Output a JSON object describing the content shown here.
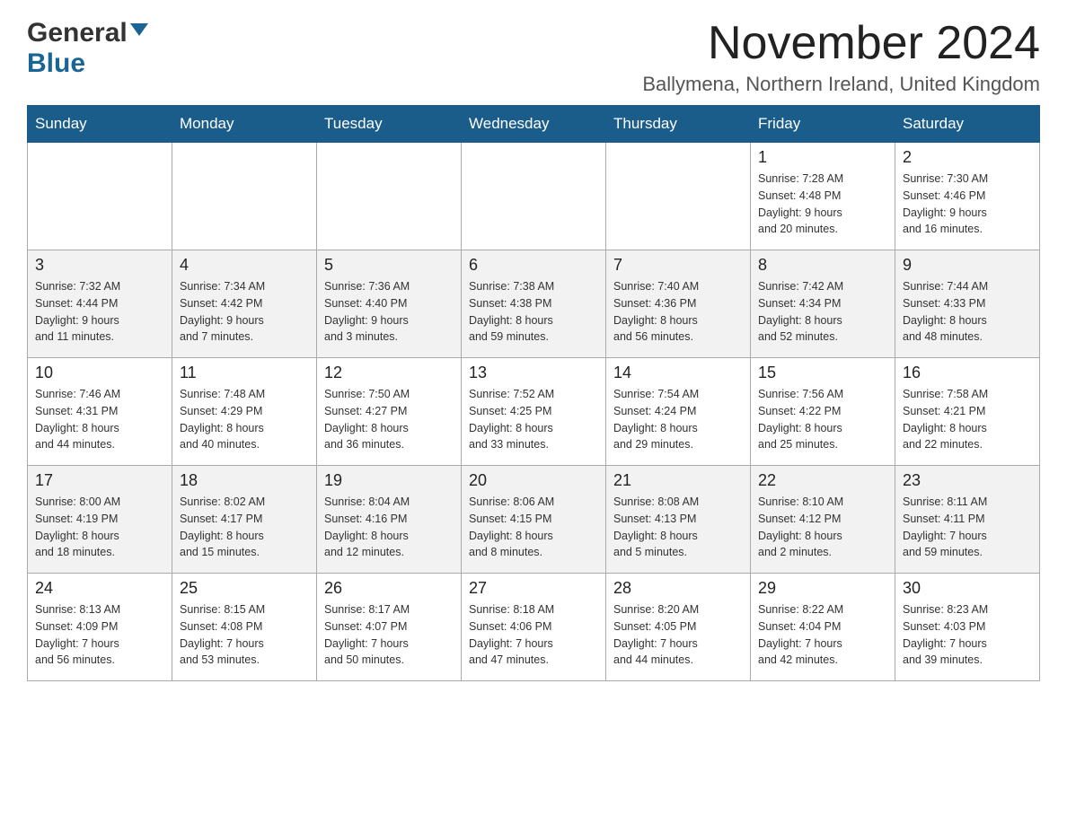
{
  "header": {
    "logo_general": "General",
    "logo_blue": "Blue",
    "title": "November 2024",
    "location": "Ballymena, Northern Ireland, United Kingdom"
  },
  "days_of_week": [
    "Sunday",
    "Monday",
    "Tuesday",
    "Wednesday",
    "Thursday",
    "Friday",
    "Saturday"
  ],
  "weeks": [
    [
      {
        "day": "",
        "info": ""
      },
      {
        "day": "",
        "info": ""
      },
      {
        "day": "",
        "info": ""
      },
      {
        "day": "",
        "info": ""
      },
      {
        "day": "",
        "info": ""
      },
      {
        "day": "1",
        "info": "Sunrise: 7:28 AM\nSunset: 4:48 PM\nDaylight: 9 hours\nand 20 minutes."
      },
      {
        "day": "2",
        "info": "Sunrise: 7:30 AM\nSunset: 4:46 PM\nDaylight: 9 hours\nand 16 minutes."
      }
    ],
    [
      {
        "day": "3",
        "info": "Sunrise: 7:32 AM\nSunset: 4:44 PM\nDaylight: 9 hours\nand 11 minutes."
      },
      {
        "day": "4",
        "info": "Sunrise: 7:34 AM\nSunset: 4:42 PM\nDaylight: 9 hours\nand 7 minutes."
      },
      {
        "day": "5",
        "info": "Sunrise: 7:36 AM\nSunset: 4:40 PM\nDaylight: 9 hours\nand 3 minutes."
      },
      {
        "day": "6",
        "info": "Sunrise: 7:38 AM\nSunset: 4:38 PM\nDaylight: 8 hours\nand 59 minutes."
      },
      {
        "day": "7",
        "info": "Sunrise: 7:40 AM\nSunset: 4:36 PM\nDaylight: 8 hours\nand 56 minutes."
      },
      {
        "day": "8",
        "info": "Sunrise: 7:42 AM\nSunset: 4:34 PM\nDaylight: 8 hours\nand 52 minutes."
      },
      {
        "day": "9",
        "info": "Sunrise: 7:44 AM\nSunset: 4:33 PM\nDaylight: 8 hours\nand 48 minutes."
      }
    ],
    [
      {
        "day": "10",
        "info": "Sunrise: 7:46 AM\nSunset: 4:31 PM\nDaylight: 8 hours\nand 44 minutes."
      },
      {
        "day": "11",
        "info": "Sunrise: 7:48 AM\nSunset: 4:29 PM\nDaylight: 8 hours\nand 40 minutes."
      },
      {
        "day": "12",
        "info": "Sunrise: 7:50 AM\nSunset: 4:27 PM\nDaylight: 8 hours\nand 36 minutes."
      },
      {
        "day": "13",
        "info": "Sunrise: 7:52 AM\nSunset: 4:25 PM\nDaylight: 8 hours\nand 33 minutes."
      },
      {
        "day": "14",
        "info": "Sunrise: 7:54 AM\nSunset: 4:24 PM\nDaylight: 8 hours\nand 29 minutes."
      },
      {
        "day": "15",
        "info": "Sunrise: 7:56 AM\nSunset: 4:22 PM\nDaylight: 8 hours\nand 25 minutes."
      },
      {
        "day": "16",
        "info": "Sunrise: 7:58 AM\nSunset: 4:21 PM\nDaylight: 8 hours\nand 22 minutes."
      }
    ],
    [
      {
        "day": "17",
        "info": "Sunrise: 8:00 AM\nSunset: 4:19 PM\nDaylight: 8 hours\nand 18 minutes."
      },
      {
        "day": "18",
        "info": "Sunrise: 8:02 AM\nSunset: 4:17 PM\nDaylight: 8 hours\nand 15 minutes."
      },
      {
        "day": "19",
        "info": "Sunrise: 8:04 AM\nSunset: 4:16 PM\nDaylight: 8 hours\nand 12 minutes."
      },
      {
        "day": "20",
        "info": "Sunrise: 8:06 AM\nSunset: 4:15 PM\nDaylight: 8 hours\nand 8 minutes."
      },
      {
        "day": "21",
        "info": "Sunrise: 8:08 AM\nSunset: 4:13 PM\nDaylight: 8 hours\nand 5 minutes."
      },
      {
        "day": "22",
        "info": "Sunrise: 8:10 AM\nSunset: 4:12 PM\nDaylight: 8 hours\nand 2 minutes."
      },
      {
        "day": "23",
        "info": "Sunrise: 8:11 AM\nSunset: 4:11 PM\nDaylight: 7 hours\nand 59 minutes."
      }
    ],
    [
      {
        "day": "24",
        "info": "Sunrise: 8:13 AM\nSunset: 4:09 PM\nDaylight: 7 hours\nand 56 minutes."
      },
      {
        "day": "25",
        "info": "Sunrise: 8:15 AM\nSunset: 4:08 PM\nDaylight: 7 hours\nand 53 minutes."
      },
      {
        "day": "26",
        "info": "Sunrise: 8:17 AM\nSunset: 4:07 PM\nDaylight: 7 hours\nand 50 minutes."
      },
      {
        "day": "27",
        "info": "Sunrise: 8:18 AM\nSunset: 4:06 PM\nDaylight: 7 hours\nand 47 minutes."
      },
      {
        "day": "28",
        "info": "Sunrise: 8:20 AM\nSunset: 4:05 PM\nDaylight: 7 hours\nand 44 minutes."
      },
      {
        "day": "29",
        "info": "Sunrise: 8:22 AM\nSunset: 4:04 PM\nDaylight: 7 hours\nand 42 minutes."
      },
      {
        "day": "30",
        "info": "Sunrise: 8:23 AM\nSunset: 4:03 PM\nDaylight: 7 hours\nand 39 minutes."
      }
    ]
  ]
}
